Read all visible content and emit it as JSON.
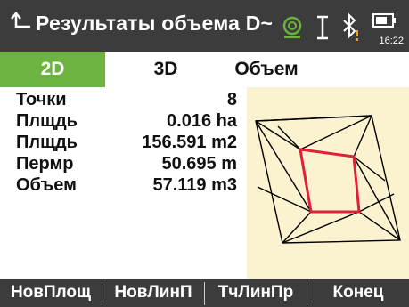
{
  "header": {
    "title": "Результаты объема D~",
    "time": "16:22",
    "icons": [
      "back-arrow-icon",
      "target-status-icon",
      "cursor-text-icon",
      "bluetooth-warning-icon",
      "battery-icon"
    ]
  },
  "tabs": [
    {
      "label": "2D",
      "active": true
    },
    {
      "label": "3D",
      "active": false
    },
    {
      "label": "Объем",
      "active": false
    }
  ],
  "results": [
    {
      "label": "Точки",
      "value": "8"
    },
    {
      "label": "Плщдь",
      "value": "0.016 ha"
    },
    {
      "label": "Плщдь",
      "value": "156.591 m2"
    },
    {
      "label": "Пермр",
      "value": "50.695 m"
    },
    {
      "label": "Объем",
      "value": "57.119 m3"
    }
  ],
  "function_keys": [
    {
      "label": "НовПлощ"
    },
    {
      "label": "НовЛинП"
    },
    {
      "label": "ТчЛинПр"
    },
    {
      "label": "Конец"
    }
  ],
  "colors": {
    "titlebar": "#3c3c3c",
    "active_tab": "#6db33f",
    "plot_background": "#fbf3cf",
    "boundary": "#e0203a",
    "mesh": "#000000",
    "warning": "#f0a020"
  }
}
